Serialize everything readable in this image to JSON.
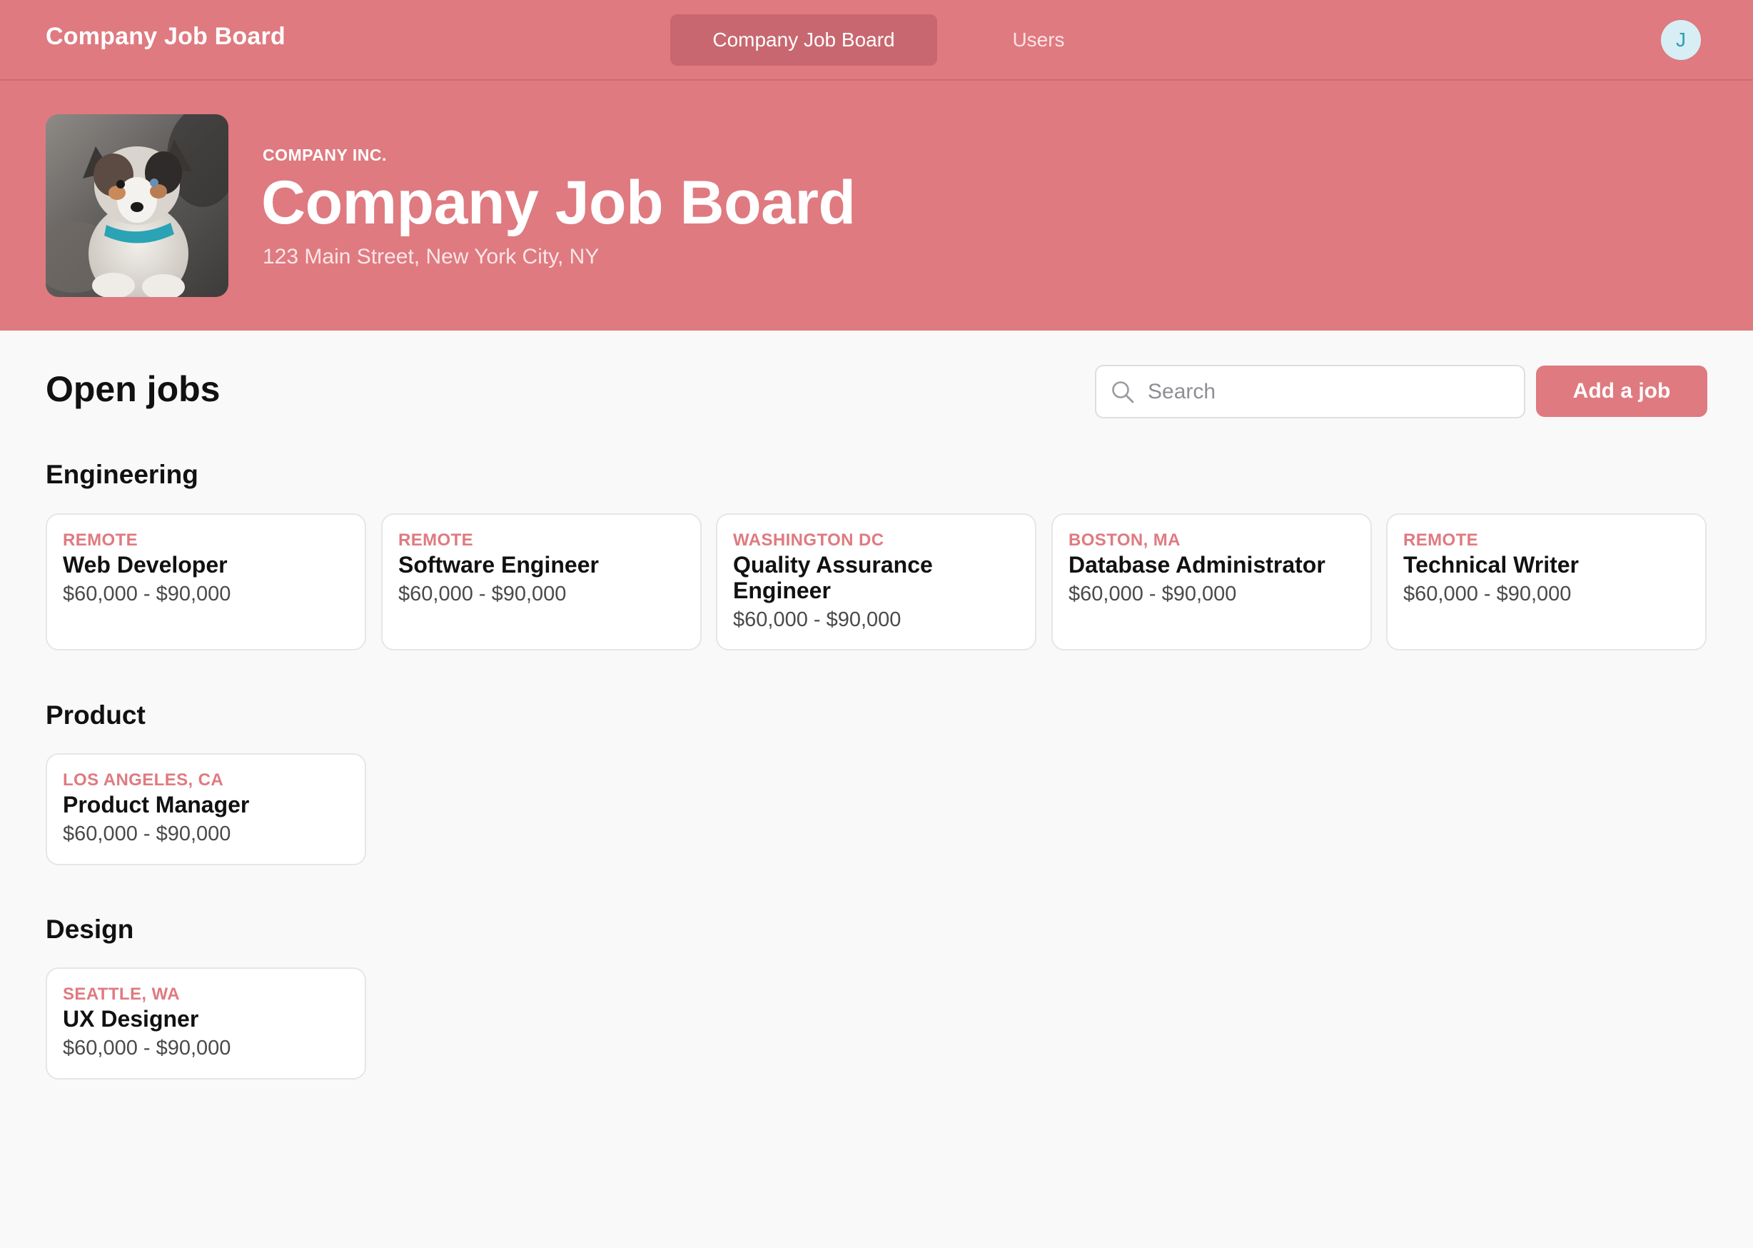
{
  "header": {
    "brand": "Company Job Board",
    "nav": [
      {
        "label": "Company Job Board",
        "active": true
      },
      {
        "label": "Users",
        "active": false
      }
    ],
    "avatar_initial": "J"
  },
  "hero": {
    "kicker": "COMPANY INC.",
    "title": "Company Job Board",
    "address": "123 Main Street, New York City, NY",
    "image": "puppy-photo"
  },
  "main": {
    "heading": "Open jobs",
    "search_placeholder": "Search",
    "search_value": "",
    "add_label": "Add a job"
  },
  "sections": [
    {
      "title": "Engineering",
      "jobs": [
        {
          "location": "REMOTE",
          "title": "Web Developer",
          "salary": "$60,000 - $90,000"
        },
        {
          "location": "REMOTE",
          "title": "Software Engineer",
          "salary": "$60,000 - $90,000"
        },
        {
          "location": "WASHINGTON DC",
          "title": "Quality Assurance Engineer",
          "salary": "$60,000 - $90,000"
        },
        {
          "location": "BOSTON, MA",
          "title": "Database Administrator",
          "salary": "$60,000 - $90,000"
        },
        {
          "location": "REMOTE",
          "title": "Technical Writer",
          "salary": "$60,000 - $90,000"
        }
      ]
    },
    {
      "title": "Product",
      "jobs": [
        {
          "location": "LOS ANGELES, CA",
          "title": "Product Manager",
          "salary": "$60,000 - $90,000"
        }
      ]
    },
    {
      "title": "Design",
      "jobs": [
        {
          "location": "SEATTLE, WA",
          "title": "UX Designer",
          "salary": "$60,000 - $90,000"
        }
      ]
    }
  ],
  "colors": {
    "accent": "#df7a80",
    "accent_dark": "#c8676f",
    "background": "#f9f9f9",
    "avatar_bg": "#d7eef5",
    "avatar_fg": "#2b9fb5"
  }
}
